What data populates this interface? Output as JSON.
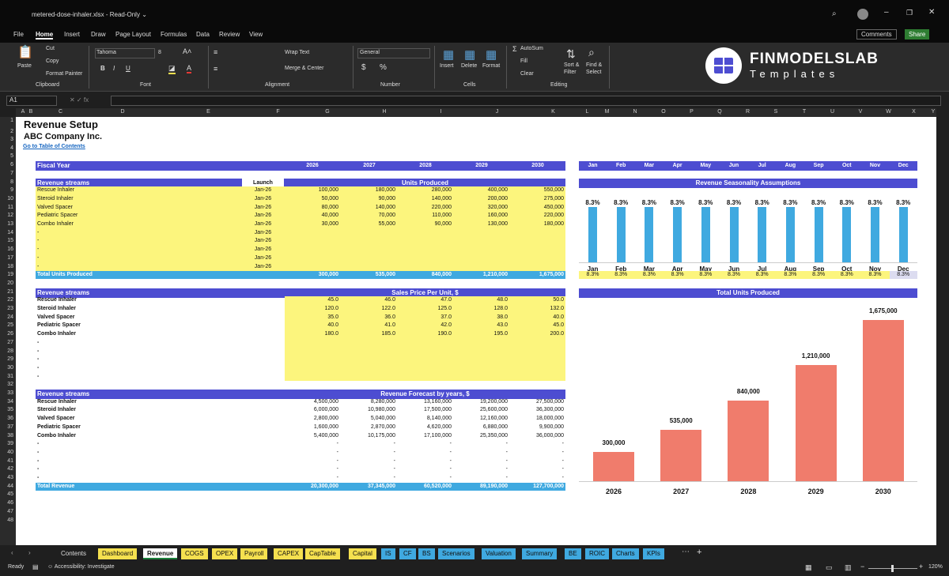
{
  "window": {
    "filename": "metered-dose-inhaler.xlsx",
    "mode": "Read-Only"
  },
  "menu": [
    "File",
    "Home",
    "Insert",
    "Draw",
    "Page Layout",
    "Formulas",
    "Data",
    "Review",
    "View"
  ],
  "header_buttons": {
    "comments": "Comments",
    "share": "Share"
  },
  "ribbon": {
    "paste": "Paste",
    "cut": "Cut",
    "copy": "Copy",
    "format_painter": "Format Painter",
    "clipboard": "Clipboard",
    "font_name": "Tahoma",
    "font_size": "8",
    "font": "Font",
    "wrap": "Wrap Text",
    "merge": "Merge & Center",
    "alignment": "Alignment",
    "number_format": "General",
    "number": "Number",
    "insert": "Insert",
    "delete": "Delete",
    "format": "Format",
    "cells": "Cells",
    "autosum": "AutoSum",
    "fill": "Fill",
    "clear": "Clear",
    "sort": "Sort &",
    "sort2": "Filter",
    "find": "Find &",
    "find2": "Select",
    "editing": "Editing"
  },
  "logo": {
    "line1": "FINMODELSLAB",
    "line2": "Templates"
  },
  "name_box": "A1",
  "columns": [
    "A",
    "B",
    "C",
    "D",
    "E",
    "F",
    "G",
    "H",
    "I",
    "J",
    "K",
    "L",
    "M",
    "N",
    "O",
    "P",
    "Q",
    "R",
    "S",
    "T",
    "U",
    "V",
    "W",
    "X",
    "Y"
  ],
  "rows": [
    "1",
    "2",
    "3",
    "4",
    "5",
    "6",
    "7",
    "8",
    "9",
    "10",
    "11",
    "12",
    "13",
    "14",
    "15",
    "16",
    "17",
    "18",
    "19",
    "20",
    "21",
    "22",
    "23",
    "24",
    "25",
    "26",
    "27",
    "28",
    "29",
    "30",
    "31",
    "32",
    "33",
    "34",
    "35",
    "36",
    "37",
    "38",
    "39",
    "40",
    "41",
    "42",
    "43",
    "44",
    "45",
    "46",
    "47",
    "48"
  ],
  "sheet": {
    "title": "Revenue Setup",
    "company": "ABC Company Inc.",
    "toc_link": "Go to Table of Contents",
    "fiscal_year": "Fiscal Year",
    "years": [
      "2026",
      "2027",
      "2028",
      "2029",
      "2030"
    ],
    "months": [
      "Jan",
      "Feb",
      "Mar",
      "Apr",
      "May",
      "Jun",
      "Jul",
      "Aug",
      "Sep",
      "Oct",
      "Nov",
      "Dec"
    ],
    "streams_label": "Revenue streams",
    "launch_label": "Launch",
    "units_label": "Units Produced",
    "streams": [
      "Rescue Inhaler",
      "Steroid Inhaler",
      "Valved Spacer",
      "Pediatric Spacer",
      "Combo Inhaler",
      "-",
      "-",
      "-",
      "-",
      "-"
    ],
    "launch": [
      "Jan-26",
      "Jan-26",
      "Jan-26",
      "Jan-26",
      "Jan-26",
      "Jan-26",
      "Jan-26",
      "Jan-26",
      "Jan-26",
      "Jan-26"
    ],
    "units": [
      [
        "100,000",
        "180,000",
        "280,000",
        "400,000",
        "550,000"
      ],
      [
        "50,000",
        "90,000",
        "140,000",
        "200,000",
        "275,000"
      ],
      [
        "80,000",
        "140,000",
        "220,000",
        "320,000",
        "450,000"
      ],
      [
        "40,000",
        "70,000",
        "110,000",
        "160,000",
        "220,000"
      ],
      [
        "30,000",
        "55,000",
        "90,000",
        "130,000",
        "180,000"
      ]
    ],
    "total_units_label": "Total Units Produced",
    "total_units": [
      "300,000",
      "535,000",
      "840,000",
      "1,210,000",
      "1,675,000"
    ],
    "price_label": "Sales Price Per Unit, $",
    "prices": [
      [
        "45.0",
        "46.0",
        "47.0",
        "48.0",
        "50.0"
      ],
      [
        "120.0",
        "122.0",
        "125.0",
        "128.0",
        "132.0"
      ],
      [
        "35.0",
        "36.0",
        "37.0",
        "38.0",
        "40.0"
      ],
      [
        "40.0",
        "41.0",
        "42.0",
        "43.0",
        "45.0"
      ],
      [
        "180.0",
        "185.0",
        "190.0",
        "195.0",
        "200.0"
      ]
    ],
    "rev_label": "Revenue Forecast by years, $",
    "revenue": [
      [
        "4,500,000",
        "8,280,000",
        "13,160,000",
        "19,200,000",
        "27,500,000"
      ],
      [
        "6,000,000",
        "10,980,000",
        "17,500,000",
        "25,600,000",
        "36,300,000"
      ],
      [
        "2,800,000",
        "5,040,000",
        "8,140,000",
        "12,160,000",
        "18,000,000"
      ],
      [
        "1,600,000",
        "2,870,000",
        "4,620,000",
        "6,880,000",
        "9,900,000"
      ],
      [
        "5,400,000",
        "10,175,000",
        "17,100,000",
        "25,350,000",
        "36,000,000"
      ]
    ],
    "total_rev_label": "Total Revenue",
    "total_rev": [
      "20,300,000",
      "37,345,000",
      "60,520,000",
      "89,190,000",
      "127,700,000"
    ],
    "season_title": "Revenue Seasonality Assumptions",
    "season_pct": "8.3%",
    "units_chart_title": "Total Units Produced"
  },
  "chart_data": [
    {
      "type": "bar",
      "title": "Revenue Seasonality Assumptions",
      "categories": [
        "Jan",
        "Feb",
        "Mar",
        "Apr",
        "May",
        "Jun",
        "Jul",
        "Aug",
        "Sep",
        "Oct",
        "Nov",
        "Dec"
      ],
      "values": [
        8.3,
        8.3,
        8.3,
        8.3,
        8.3,
        8.3,
        8.3,
        8.3,
        8.3,
        8.3,
        8.3,
        8.3
      ],
      "labels": [
        "8.3%",
        "8.3%",
        "8.3%",
        "8.3%",
        "8.3%",
        "8.3%",
        "8.3%",
        "8.3%",
        "8.3%",
        "8.3%",
        "8.3%",
        "8.3%"
      ],
      "color": "#3fa9e0"
    },
    {
      "type": "bar",
      "title": "Total Units Produced",
      "categories": [
        "2026",
        "2027",
        "2028",
        "2029",
        "2030"
      ],
      "values": [
        300000,
        535000,
        840000,
        1210000,
        1675000
      ],
      "labels": [
        "300,000",
        "535,000",
        "840,000",
        "1,210,000",
        "1,675,000"
      ],
      "color": "#f07c6c"
    }
  ],
  "tabs": [
    {
      "label": "Contents",
      "color": "#1f1f1f",
      "fg": "#ddd"
    },
    {
      "label": "Dashboard",
      "color": "#f5e04f"
    },
    {
      "label": "Revenue",
      "color": "#ffffff",
      "active": true
    },
    {
      "label": "COGS",
      "color": "#f5e04f"
    },
    {
      "label": "OPEX",
      "color": "#f5e04f"
    },
    {
      "label": "Payroll",
      "color": "#f5e04f"
    },
    {
      "label": "CAPEX",
      "color": "#f5e04f"
    },
    {
      "label": "CapTable",
      "color": "#f5e04f"
    },
    {
      "label": "Capital",
      "color": "#f5e04f"
    },
    {
      "label": "IS",
      "color": "#3fa9e0"
    },
    {
      "label": "CF",
      "color": "#3fa9e0"
    },
    {
      "label": "BS",
      "color": "#3fa9e0"
    },
    {
      "label": "Scenarios",
      "color": "#3fa9e0"
    },
    {
      "label": "Valuation",
      "color": "#3fa9e0"
    },
    {
      "label": "Summary",
      "color": "#3fa9e0"
    },
    {
      "label": "BE",
      "color": "#3fa9e0"
    },
    {
      "label": "ROIC",
      "color": "#3fa9e0"
    },
    {
      "label": "Charts",
      "color": "#3fa9e0"
    },
    {
      "label": "KPIs",
      "color": "#3fa9e0"
    }
  ],
  "status": {
    "ready": "Ready",
    "accessibility": "Accessibility: Investigate",
    "zoom": "120%"
  }
}
